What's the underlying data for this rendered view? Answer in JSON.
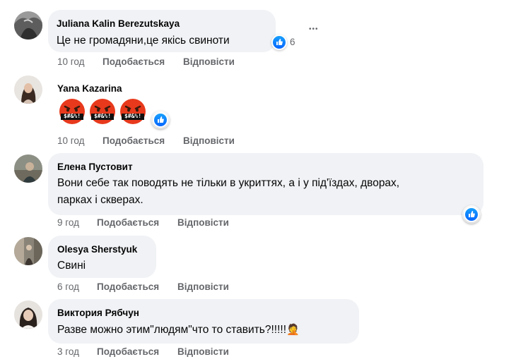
{
  "colors": {
    "like_blue": "#0866ff",
    "bubble_bg": "#f0f2f5",
    "meta_gray": "#65676b"
  },
  "comments": [
    {
      "author": "Juliana Kalin Berezutskaya",
      "text": "Це не громадяни,це якісь свиноти",
      "time": "10 год",
      "like_label": "Подобається",
      "reply_label": "Відповісти",
      "reaction_icon": "like-icon",
      "reaction_count": "6",
      "more_label": "•••"
    },
    {
      "author": "Yana Kazarina",
      "emoji_text": "$#&%!",
      "emoji_name": "cursing-face-emoji",
      "emoji_count": 3,
      "time": "10 год",
      "like_label": "Подобається",
      "reply_label": "Відповісти",
      "reaction_icon": "like-icon"
    },
    {
      "author": "Елена Пустовит",
      "text_line1": "Вони себе так поводять не тільки в укриттях, а і у під'їздах, дворах,",
      "text_line2": "парках і скверах.",
      "time": "9 год",
      "like_label": "Подобається",
      "reply_label": "Відповісти",
      "reaction_icon": "like-icon"
    },
    {
      "author": "Olesya Sherstyuk",
      "text": "Свині",
      "time": "6 год",
      "like_label": "Подобається",
      "reply_label": "Відповісти"
    },
    {
      "author": "Виктория Рябчун",
      "text": "Разве можно этим\"людям\"что то ставить?!!!!!",
      "text_emoji": "🤦",
      "time": "3 год",
      "like_label": "Подобається",
      "reply_label": "Відповісти"
    }
  ]
}
